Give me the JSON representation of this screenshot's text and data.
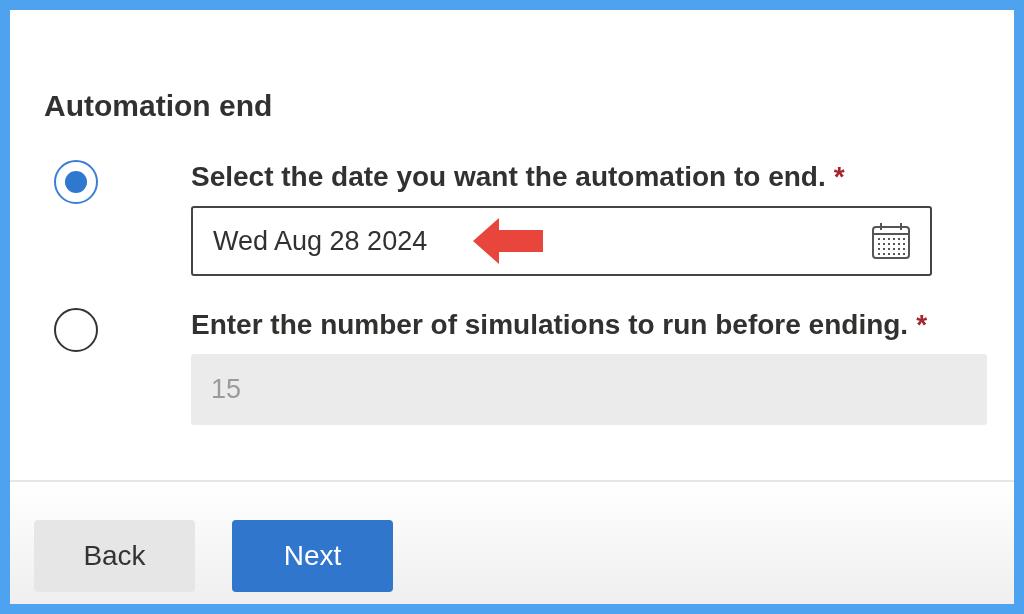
{
  "heading": "Automation end",
  "options": [
    {
      "kind": "date",
      "label": "Select the date you want the automation to end.",
      "required_mark": "*",
      "selected": true,
      "value": "Wed Aug 28 2024",
      "disabled": false
    },
    {
      "kind": "number",
      "label": "Enter the number of simulations to run before ending.",
      "required_mark": "*",
      "selected": false,
      "value": "15",
      "disabled": true
    }
  ],
  "buttons": [
    {
      "label": "Back",
      "kind": "secondary"
    },
    {
      "label": "Next",
      "kind": "primary"
    }
  ]
}
